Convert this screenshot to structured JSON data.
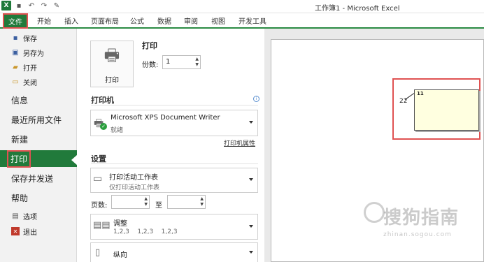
{
  "window": {
    "title": "工作簿1 - Microsoft Excel"
  },
  "quick_access": [
    "excel-icon",
    "save-icon",
    "undo-icon",
    "redo-icon",
    "format-painter-icon"
  ],
  "ribbon": {
    "file": "文件",
    "tabs": [
      "开始",
      "插入",
      "页面布局",
      "公式",
      "数据",
      "审阅",
      "视图",
      "开发工具"
    ]
  },
  "nav": {
    "small_top": [
      {
        "label": "保存",
        "icon": "save-icon"
      },
      {
        "label": "另存为",
        "icon": "save-as-icon"
      },
      {
        "label": "打开",
        "icon": "open-folder-icon"
      },
      {
        "label": "关闭",
        "icon": "close-file-icon"
      }
    ],
    "big": [
      "信息",
      "最近所用文件",
      "新建",
      "打印",
      "保存并发送",
      "帮助"
    ],
    "active": "打印",
    "small_bottom": [
      {
        "label": "选项",
        "icon": "options-icon"
      },
      {
        "label": "退出",
        "icon": "exit-icon"
      }
    ]
  },
  "print": {
    "heading": "打印",
    "button_label": "打印",
    "copies_label": "份数:",
    "copies_value": "1"
  },
  "printer": {
    "section": "打印机",
    "name": "Microsoft XPS Document Writer",
    "status": "就绪",
    "properties_link": "打印机属性"
  },
  "settings": {
    "section": "设置",
    "what": {
      "main": "打印活动工作表",
      "sub": "仅打印活动工作表"
    },
    "pages_label": "页数:",
    "to_label": "至",
    "collate": {
      "main": "调整",
      "sub": "1,2,3    1,2,3    1,2,3"
    },
    "orientation": {
      "main": "纵向"
    }
  },
  "preview": {
    "comment_author": "11",
    "cell_value": "22"
  },
  "watermark": {
    "main": "搜狗指南",
    "sub": "zhinan.sogou.com"
  },
  "colors": {
    "accent_green": "#217a3b",
    "highlight_red": "#e05252"
  }
}
